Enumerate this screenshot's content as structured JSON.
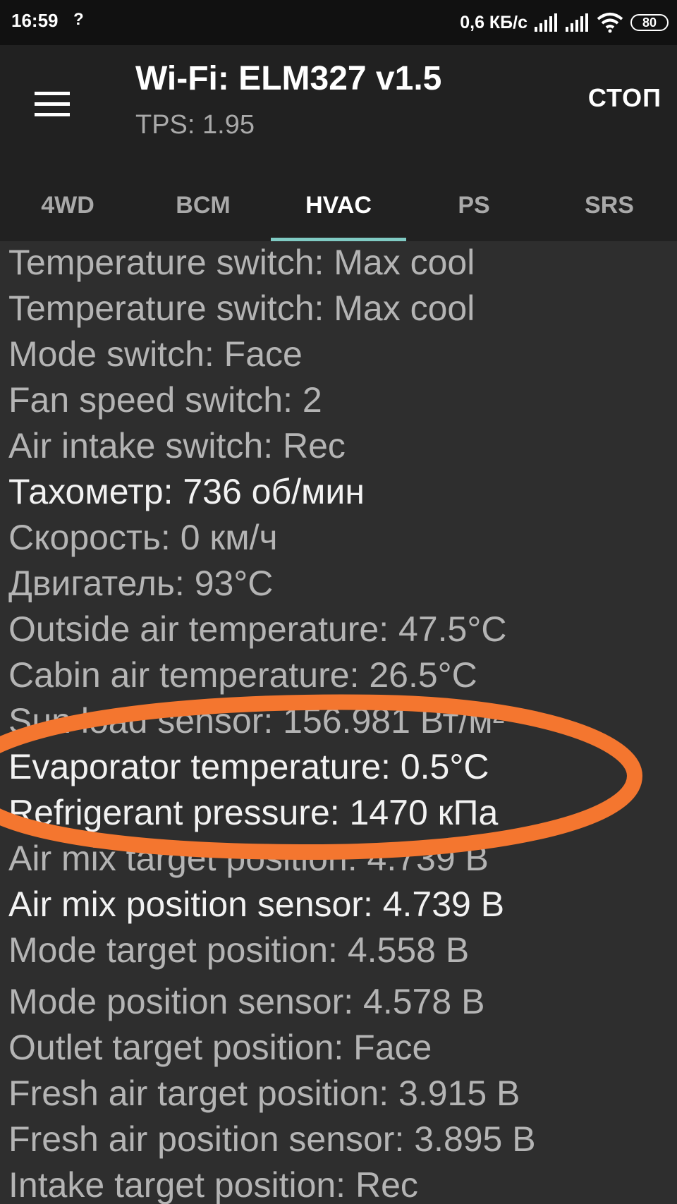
{
  "status_bar": {
    "time": "16:59",
    "question_mark": "?",
    "speed": "0,6 КБ/с",
    "battery": "80",
    "icons": [
      "signal-icon",
      "signal-icon",
      "wifi-icon",
      "battery-icon"
    ]
  },
  "toolbar": {
    "title": "Wi-Fi: ELM327 v1.5",
    "subtitle": "TPS: 1.95",
    "stop_label": "СТОП",
    "menu_icon": "hamburger-menu-icon"
  },
  "tabs": [
    {
      "label": "4WD",
      "active": false
    },
    {
      "label": "BCM",
      "active": false
    },
    {
      "label": "HVAC",
      "active": true
    },
    {
      "label": "PS",
      "active": false
    },
    {
      "label": "SRS",
      "active": false
    }
  ],
  "rows": [
    {
      "text": "Temperature switch: Max cool",
      "bright": false
    },
    {
      "text": "Temperature switch: Max cool",
      "bright": false
    },
    {
      "text": "Mode switch: Face",
      "bright": false
    },
    {
      "text": "Fan speed switch: 2",
      "bright": false
    },
    {
      "text": "Air intake switch: Rec",
      "bright": false
    },
    {
      "text": "Тахометр: 736 об/мин",
      "bright": true
    },
    {
      "text": "Скорость: 0 км/ч",
      "bright": false
    },
    {
      "text": "Двигатель: 93°C",
      "bright": false
    },
    {
      "text": "Outside air temperature: 47.5°C",
      "bright": false
    },
    {
      "text": "Cabin air temperature: 26.5°C",
      "bright": false
    },
    {
      "text": "Sun load sensor: 156.981 Вт/м²",
      "bright": false
    },
    {
      "text": "Evaporator temperature: 0.5°C",
      "bright": true
    },
    {
      "text": "Refrigerant pressure: 1470 кПа",
      "bright": true
    },
    {
      "text": "Air mix target position: 4.739 В",
      "bright": false
    },
    {
      "text": "Air mix position sensor: 4.739 В",
      "bright": true
    },
    {
      "text": "Mode target position: 4.558 В",
      "bright": false
    },
    {
      "text": "Mode position sensor: 4.578 В",
      "bright": false
    },
    {
      "text": "Outlet target position: Face",
      "bright": false
    },
    {
      "text": "Fresh air target position: 3.915 В",
      "bright": false
    },
    {
      "text": "Fresh air position sensor: 3.895 В",
      "bright": false
    },
    {
      "text": "Intake target position: Rec",
      "bright": false
    }
  ],
  "annotation": {
    "shape": "ellipse",
    "color": "#f4762f",
    "encircles": "Evaporator temperature: 0.5°C"
  }
}
